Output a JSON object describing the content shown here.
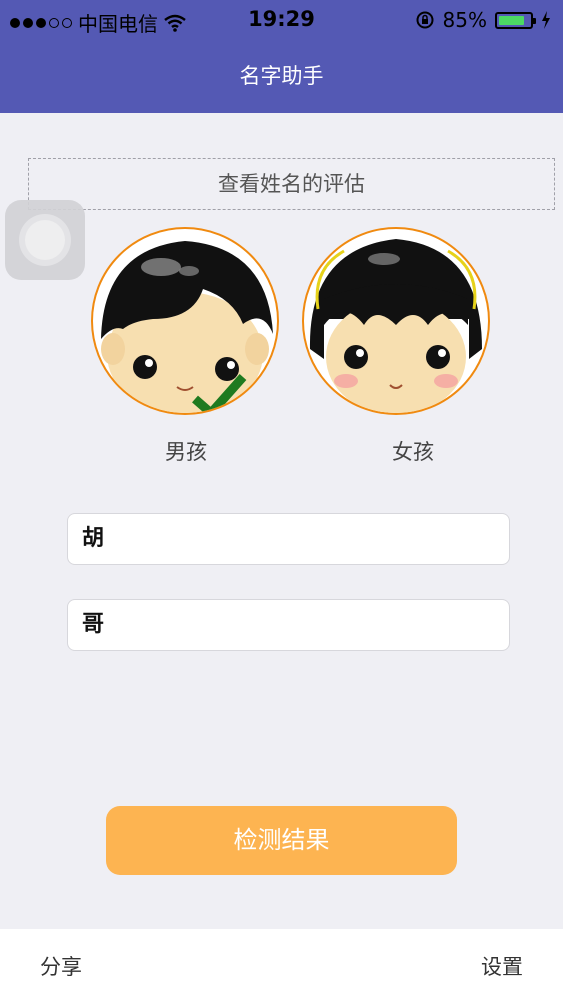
{
  "status_bar": {
    "carrier": "中国电信",
    "time": "19:29",
    "battery_percent": "85%",
    "battery_level": 0.85,
    "signal_bars": 3
  },
  "nav": {
    "title": "名字助手"
  },
  "banner": {
    "label": "查看姓名的评估"
  },
  "gender": {
    "boy_label": "男孩",
    "girl_label": "女孩",
    "selected": "boy"
  },
  "form": {
    "surname_value": "胡",
    "given_name_value": "哥"
  },
  "actions": {
    "check_label": "检测结果"
  },
  "bottom_bar": {
    "share_label": "分享",
    "settings_label": "设置"
  },
  "colors": {
    "nav": "#5459b4",
    "accent": "#fdb451",
    "avatar_border": "#f08a10",
    "check": "#1f7a1f"
  }
}
